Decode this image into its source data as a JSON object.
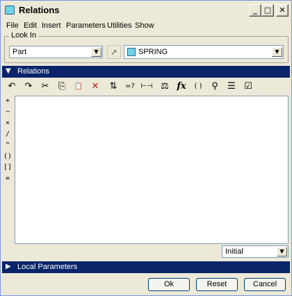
{
  "window": {
    "title": "Relations",
    "min_glyph": "_",
    "max_glyph": "□",
    "close_glyph": "✕"
  },
  "menu": [
    "File",
    "Edit",
    "Insert",
    "Parameters",
    "Utilities",
    "Show"
  ],
  "look_in": {
    "label": "Look In",
    "type_value": "Part",
    "model_value": "SPRING",
    "select_glyph": "➚"
  },
  "relations": {
    "label": "Relations",
    "toggle_glyph": "▼"
  },
  "toolbar": [
    {
      "name": "undo-icon",
      "glyph": "↶"
    },
    {
      "name": "redo-icon",
      "glyph": "↷"
    },
    {
      "name": "cut-icon",
      "glyph": "✂"
    },
    {
      "name": "copy-icon",
      "glyph": "⎘"
    },
    {
      "name": "paste-icon",
      "glyph": "📋"
    },
    {
      "name": "delete-icon",
      "glyph": "✕"
    },
    {
      "name": "sort-icon",
      "glyph": "⇅"
    },
    {
      "name": "evaluate-icon",
      "glyph": "=?"
    },
    {
      "name": "dimension-icon",
      "glyph": "⊢⊣"
    },
    {
      "name": "units-icon",
      "glyph": "⚖"
    },
    {
      "name": "function-icon",
      "glyph": "fx"
    },
    {
      "name": "brackets-icon",
      "glyph": "( )"
    },
    {
      "name": "parameters-icon",
      "glyph": "⚲"
    },
    {
      "name": "list-icon",
      "glyph": "☰"
    },
    {
      "name": "verify-icon",
      "glyph": "☑"
    }
  ],
  "operators": [
    "+",
    "−",
    "×",
    "/",
    "^",
    "()",
    "[]",
    "="
  ],
  "editor_text": "",
  "sort_value": "Initial",
  "local_parameters": {
    "label": "Local Parameters",
    "toggle_glyph": "▶"
  },
  "buttons": {
    "ok": "Ok",
    "reset": "Reset",
    "cancel": "Cancel"
  },
  "dropdown_glyph": "▼"
}
